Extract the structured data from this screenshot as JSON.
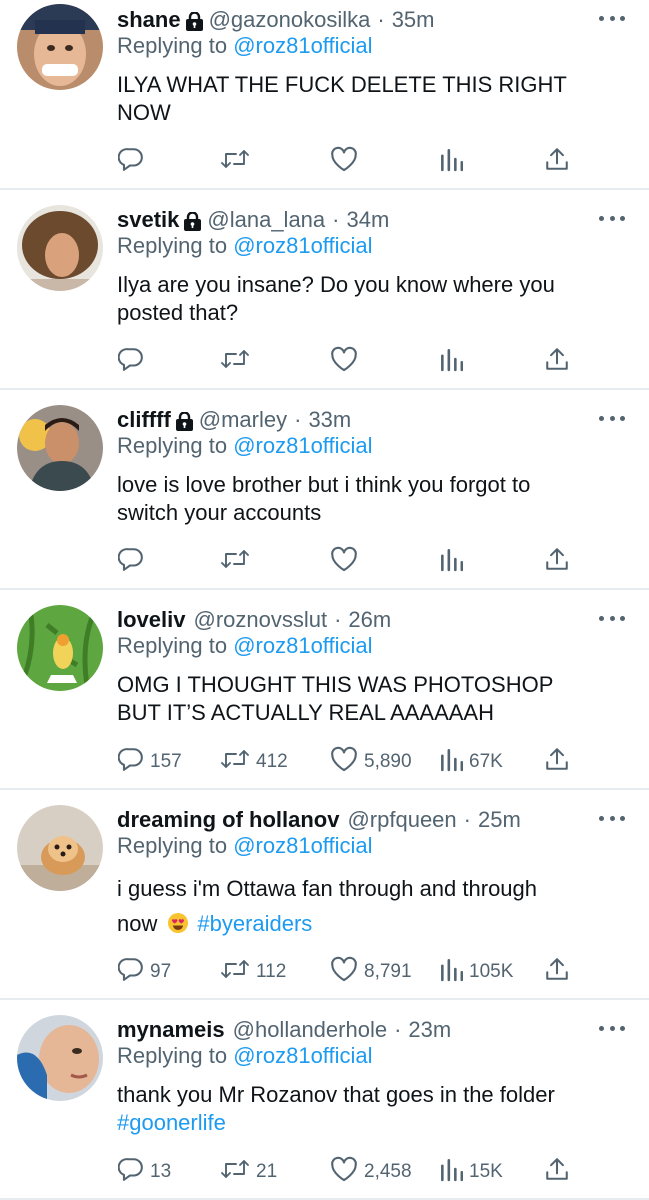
{
  "replying_label": "Replying to",
  "replies": [
    {
      "display_name": "shane",
      "locked": true,
      "handle": "@gazonokosilka",
      "sep": "·",
      "time": "35m",
      "replying_to": "@roz81official",
      "text_lines": [
        "ILYA WHAT THE FUCK DELETE THIS RIGHT",
        "NOW"
      ],
      "stats": {
        "replies": "",
        "retweets": "",
        "likes": "",
        "views": ""
      }
    },
    {
      "display_name": "svetik",
      "locked": true,
      "handle": "@lana_lana",
      "sep": "·",
      "time": "34m",
      "replying_to": "@roz81official",
      "text_lines": [
        "Ilya are you insane? Do you know where you",
        "posted that?"
      ],
      "stats": {
        "replies": "",
        "retweets": "",
        "likes": "",
        "views": ""
      }
    },
    {
      "display_name": "cliffff",
      "locked": true,
      "handle": "@marley",
      "sep": "·",
      "time": "33m",
      "replying_to": "@roz81official",
      "text_lines": [
        "love is love brother but i think you forgot to",
        "switch your accounts"
      ],
      "stats": {
        "replies": "",
        "retweets": "",
        "likes": "",
        "views": ""
      }
    },
    {
      "display_name": "loveliv",
      "locked": false,
      "handle": "@roznovsslut",
      "sep": "·",
      "time": "26m",
      "replying_to": "@roz81official",
      "text_lines": [
        "OMG I THOUGHT THIS WAS PHOTOSHOP",
        "BUT IT’S ACTUALLY REAL AAAAAAH"
      ],
      "stats": {
        "replies": "157",
        "retweets": "412",
        "likes": "5,890",
        "views": "67K"
      }
    },
    {
      "display_name": "dreaming of hollanov",
      "locked": false,
      "handle": "@rpfqueen",
      "sep": "·",
      "time": "25m",
      "replying_to": "@roz81official",
      "text_line1": "i guess i'm Ottawa fan through and through",
      "text_line2_prefix": "now",
      "emoji": "heart-eyes-emoji",
      "hashtag": "#byeraiders",
      "stats": {
        "replies": "97",
        "retweets": "112",
        "likes": "8,791",
        "views": "105K"
      }
    },
    {
      "display_name": "mynameis",
      "locked": false,
      "handle": "@hollanderhole",
      "sep": "·",
      "time": "23m",
      "replying_to": "@roz81official",
      "text_line1": "thank you Mr Rozanov that goes in the folder",
      "hashtag": "#goonerlife",
      "stats": {
        "replies": "13",
        "retweets": "21",
        "likes": "2,458",
        "views": "15K"
      }
    }
  ],
  "icons": {
    "reply": "speech-bubble-icon",
    "retweet": "retweet-icon",
    "like": "heart-icon",
    "views": "bar-chart-icon",
    "share": "share-upload-icon",
    "lock": "lock-icon",
    "more": "more-horizontal-icon"
  },
  "colors": {
    "accent": "#1d9bf0",
    "muted": "#536471",
    "text": "#0f1419",
    "divider": "#e6ecf0"
  }
}
